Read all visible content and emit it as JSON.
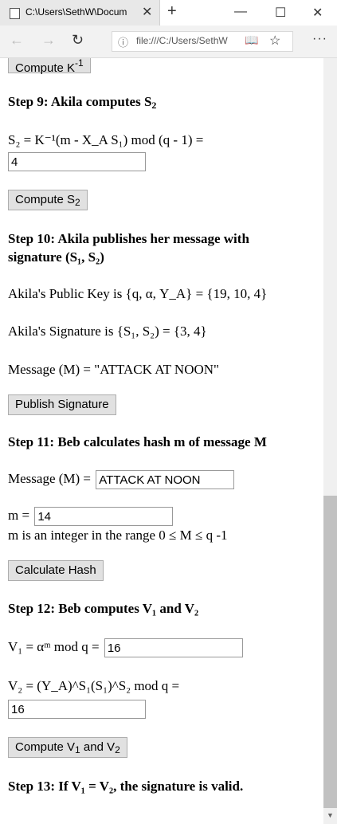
{
  "tab": {
    "title": "C:\\Users\\SethW\\Docum"
  },
  "address": {
    "url": "file:///C:/Users/SethW"
  },
  "buttons": {
    "compute_kinv": "Compute K",
    "kinv_sup": "-1",
    "compute_s2": "Compute S",
    "compute_s2_sub": "2",
    "publish": "Publish Signature",
    "calc_hash": "Calculate Hash",
    "compute_v_prefix": "Compute V",
    "compute_v_and": " and V",
    "sub1": "1",
    "sub2": "2"
  },
  "step9": {
    "heading": "Step 9: Akila computes S",
    "heading_sub": "2",
    "formula": "S₂ = K⁻¹(m - X_A S₁) mod (q - 1) =",
    "s2_value": "4"
  },
  "step10": {
    "heading_line1": "Step 10: Akila publishes her message with",
    "heading_line2": "signature (S₁, S₂)",
    "public_key": "Akila's Public Key is {q, α, Y_A} = {19, 10, 4}",
    "signature": "Akila's Signature is {S₁, S₂) = {3, 4}",
    "message": "Message (M) = \"ATTACK AT NOON\""
  },
  "step11": {
    "heading": "Step 11: Beb calculates hash m of message M",
    "message_label": "Message (M) =",
    "message_value": "ATTACK AT NOON",
    "m_label": "m =",
    "m_value": "14",
    "m_note": "m is an integer in the range 0 ≤ M ≤ q -1"
  },
  "step12": {
    "heading": "Step 12: Beb computes V₁ and V₂",
    "v1_label": "V₁ = αᵐ mod q =",
    "v1_value": "16",
    "v2_label": "V₂ = (Y_A)^S₁(S₁)^S₂ mod q =",
    "v2_value": "16"
  },
  "step13": {
    "heading": "Step 13: If V₁ = V₂, the signature is valid."
  }
}
